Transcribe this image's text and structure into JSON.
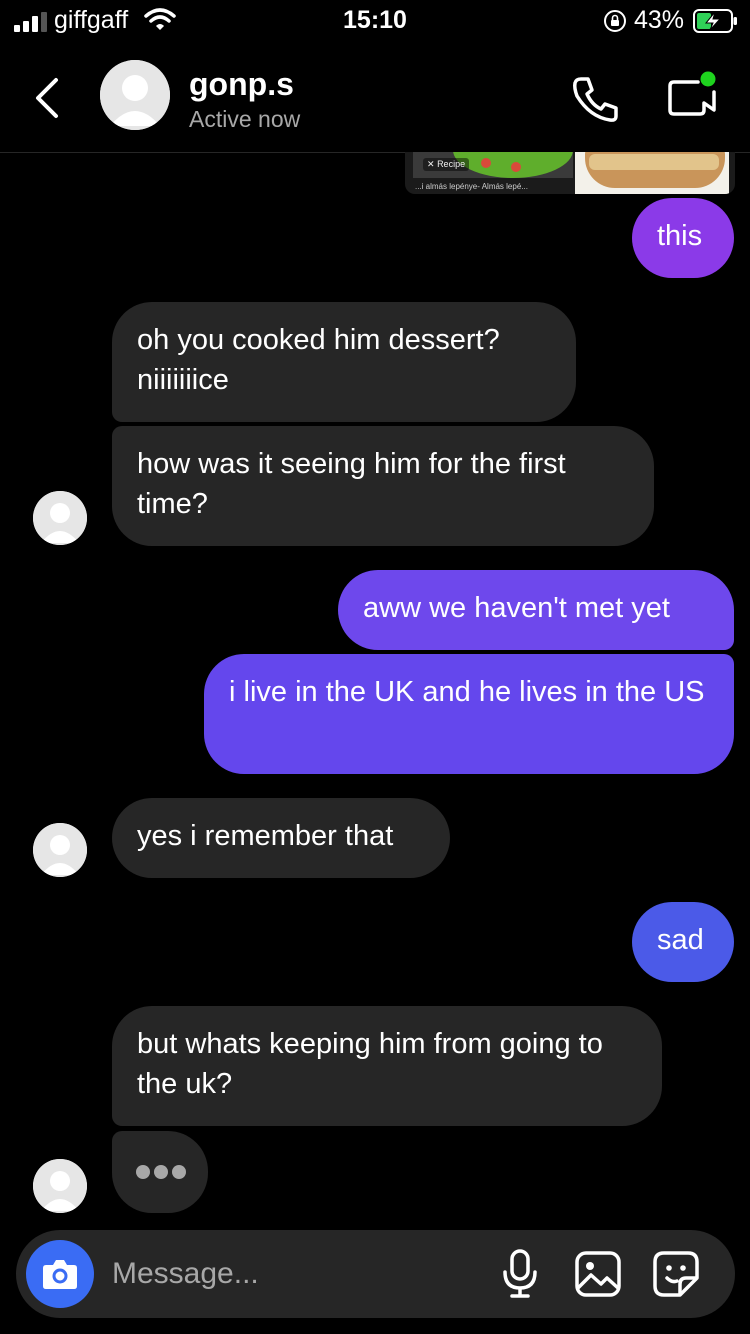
{
  "status_bar": {
    "carrier": "giffgaff",
    "time": "15:10",
    "battery_percent": "43%"
  },
  "header": {
    "contact_name": "gonp.s",
    "contact_status": "Active now",
    "icons": [
      "back-icon",
      "phone-icon",
      "video-call-icon"
    ]
  },
  "link_preview": {
    "recipe_tag": "Recipe",
    "caption": "...i almás lepénye- Almás lepé..."
  },
  "messages": [
    {
      "direction": "out",
      "text": "this",
      "color": "#8b3ae8"
    },
    {
      "direction": "in",
      "text": "oh you cooked him dessert? niiiiiiice"
    },
    {
      "direction": "in",
      "text": "how was it seeing him for the first time?"
    },
    {
      "direction": "out",
      "text": "aww we haven't met yet",
      "color": "#6e48ec"
    },
    {
      "direction": "out",
      "text": "i live in the UK and he lives in the US",
      "color": "#6447ed"
    },
    {
      "direction": "in",
      "text": "yes i remember that"
    },
    {
      "direction": "out",
      "text": "sad",
      "color": "#4b5ae8"
    },
    {
      "direction": "in",
      "text": "but whats keeping him from going to the uk?"
    }
  ],
  "typing_indicator": true,
  "composer": {
    "placeholder": "Message...",
    "icons": [
      "camera-icon",
      "microphone-icon",
      "gallery-icon",
      "sticker-icon"
    ]
  },
  "colors": {
    "background": "#000000",
    "incoming_bubble": "#262626",
    "camera_button": "#3a6cf4",
    "active_dot": "#1ed31e"
  }
}
